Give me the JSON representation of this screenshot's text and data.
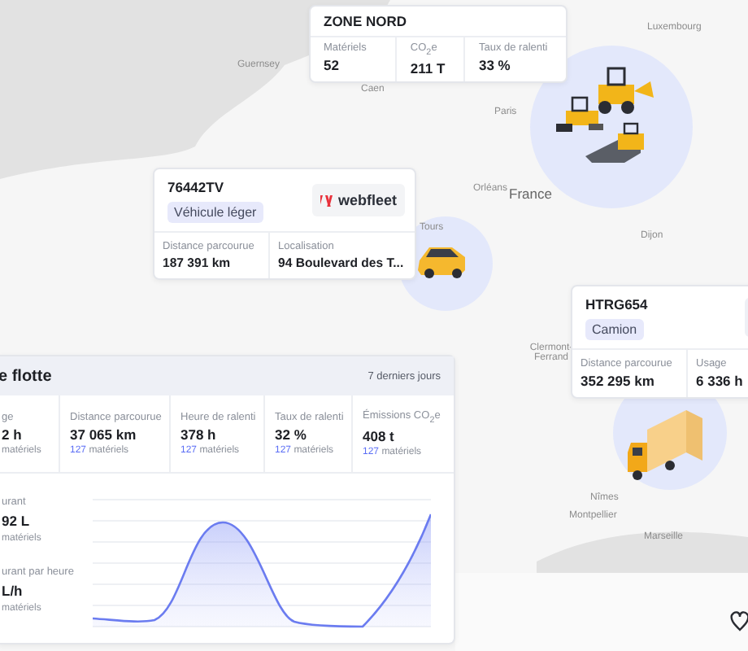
{
  "map": {
    "labels": [
      "Luxembourg",
      "Guernsey",
      "Caen",
      "Paris",
      "Orléans",
      "France",
      "Tours",
      "Dijon",
      "Clermont-Ferrand",
      "Nîmes",
      "Montpellier",
      "Marseille"
    ]
  },
  "zone_card": {
    "title": "ZONE NORD",
    "metrics": [
      {
        "label": "Matériels",
        "value": "52"
      },
      {
        "label": "CO$_{2}$e",
        "value": "211 T"
      },
      {
        "label": "Taux de ralenti",
        "value": "33 %"
      }
    ]
  },
  "vehicles": [
    {
      "kind": "car",
      "plate": "76442TV",
      "tag": "Véhicule léger",
      "logo": "webfleet",
      "metrics": [
        {
          "label": "Distance parcourue",
          "value": "187 391 km"
        },
        {
          "label": "Localisation",
          "value": "94 Boulevard des T..."
        }
      ]
    },
    {
      "kind": "truck",
      "plate": "HTRG654",
      "tag": "Camion",
      "metrics": [
        {
          "label": "Distance parcourue",
          "value": "352 295 km"
        },
        {
          "label": "Usage",
          "value": "6 336 h"
        }
      ]
    }
  ],
  "fleet_panel": {
    "title": "e flotte",
    "period": "7 derniers jours",
    "metrics": [
      {
        "label": "ge",
        "value": "2 h",
        "sub": "matériels"
      },
      {
        "label": "Distance parcourue",
        "value": "37 065 km",
        "count": "127",
        "sub": "matériels"
      },
      {
        "label": "Heure de ralenti",
        "value": "378 h",
        "count": "127",
        "sub": "matériels"
      },
      {
        "label": "Taux de ralenti",
        "value": "32 %",
        "count": "127",
        "sub": "matériels"
      },
      {
        "label": "Émissions CO$_{2}$e",
        "value": "408 t",
        "count": "127",
        "sub": "matériels"
      }
    ],
    "fuel_stats": [
      {
        "label": "urant",
        "value": "92 L",
        "sub": "matériels"
      },
      {
        "label": "urant par heure",
        "value": "L/h",
        "sub": "matériels"
      }
    ]
  }
}
